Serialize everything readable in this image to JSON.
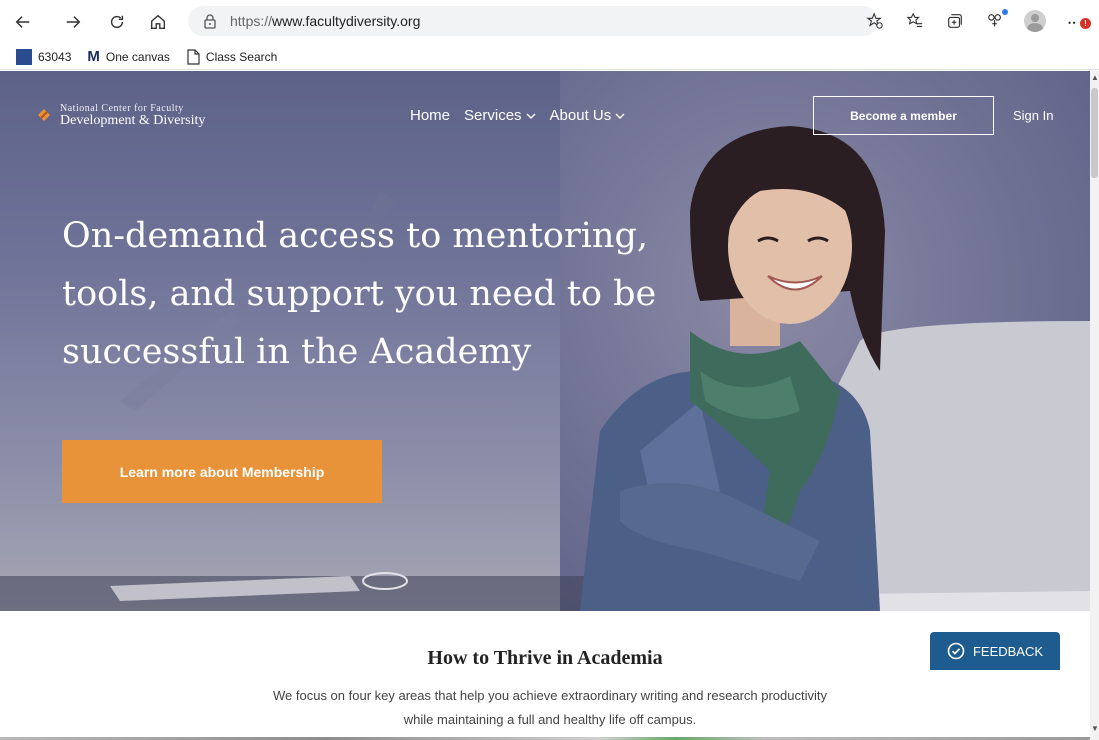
{
  "browser": {
    "url_protocol": "https://",
    "url_host": "www.facultydiversity.org",
    "alert_badge": "!"
  },
  "bookmarks": [
    {
      "label": "63043"
    },
    {
      "label": "One canvas"
    },
    {
      "label": "Class Search"
    }
  ],
  "site": {
    "logo_line1": "National Center for Faculty",
    "logo_line2": "Development & Diversity",
    "nav": {
      "home": "Home",
      "services": "Services",
      "about": "About Us"
    },
    "member_button": "Become a member",
    "sign_in": "Sign In"
  },
  "hero": {
    "title": "On-demand access to mentoring, tools, and support you need to be successful in the Academy",
    "cta": "Learn more about Membership"
  },
  "section": {
    "title": "How to Thrive in Academia",
    "text": "We focus on four key areas that help you achieve extraordinary writing and research productivity while maintaining a full and healthy life off campus."
  },
  "feedback": {
    "label": "FEEDBACK"
  },
  "colors": {
    "accent_orange": "#e8923a",
    "feedback_blue": "#1e5b8f",
    "hero_tint": "#5d6288"
  }
}
